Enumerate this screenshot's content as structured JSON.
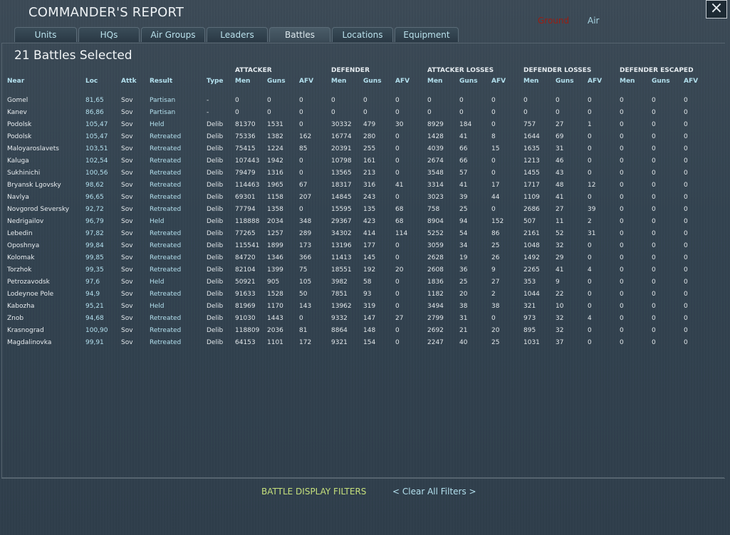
{
  "window": {
    "title": "COMMANDER'S REPORT",
    "close_label": "×"
  },
  "mode": {
    "ground": "Ground",
    "air": "Air"
  },
  "tabs": [
    {
      "label": "Units"
    },
    {
      "label": "HQs"
    },
    {
      "label": "Air Groups"
    },
    {
      "label": "Leaders"
    },
    {
      "label": "Battles",
      "active": true
    },
    {
      "label": "Locations"
    },
    {
      "label": "Equipment"
    }
  ],
  "subtitle": "21 Battles Selected",
  "group_headers": {
    "attacker": "ATTACKER",
    "defender": "DEFENDER",
    "attacker_losses": "ATTACKER LOSSES",
    "defender_losses": "DEFENDER LOSSES",
    "defender_escaped": "DEFENDER ESCAPED"
  },
  "columns": [
    "Near",
    "Loc",
    "Attk",
    "Result",
    "Type",
    "Men",
    "Guns",
    "AFV",
    "Men",
    "Guns",
    "AFV",
    "Men",
    "Guns",
    "AFV",
    "Men",
    "Guns",
    "AFV",
    "Men",
    "Guns",
    "AFV"
  ],
  "rows": [
    [
      "Gomel",
      "81,65",
      "Sov",
      "Partisan",
      "-",
      "0",
      "0",
      "0",
      "0",
      "0",
      "0",
      "0",
      "0",
      "0",
      "0",
      "0",
      "0",
      "0",
      "0",
      "0"
    ],
    [
      "Kanev",
      "86,86",
      "Sov",
      "Partisan",
      "-",
      "0",
      "0",
      "0",
      "0",
      "0",
      "0",
      "0",
      "0",
      "0",
      "0",
      "0",
      "0",
      "0",
      "0",
      "0"
    ],
    [
      "Podolsk",
      "105,47",
      "Sov",
      "Held",
      "Delib",
      "81370",
      "1531",
      "0",
      "30332",
      "479",
      "30",
      "8929",
      "184",
      "0",
      "757",
      "27",
      "1",
      "0",
      "0",
      "0"
    ],
    [
      "Podolsk",
      "105,47",
      "Sov",
      "Retreated",
      "Delib",
      "75336",
      "1382",
      "162",
      "16774",
      "280",
      "0",
      "1428",
      "41",
      "8",
      "1644",
      "69",
      "0",
      "0",
      "0",
      "0"
    ],
    [
      "Maloyaroslavets",
      "103,51",
      "Sov",
      "Retreated",
      "Delib",
      "75415",
      "1224",
      "85",
      "20391",
      "255",
      "0",
      "4039",
      "66",
      "15",
      "1635",
      "31",
      "0",
      "0",
      "0",
      "0"
    ],
    [
      "Kaluga",
      "102,54",
      "Sov",
      "Retreated",
      "Delib",
      "107443",
      "1942",
      "0",
      "10798",
      "161",
      "0",
      "2674",
      "66",
      "0",
      "1213",
      "46",
      "0",
      "0",
      "0",
      "0"
    ],
    [
      "Sukhinichi",
      "100,56",
      "Sov",
      "Retreated",
      "Delib",
      "79479",
      "1316",
      "0",
      "13565",
      "213",
      "0",
      "3548",
      "57",
      "0",
      "1455",
      "43",
      "0",
      "0",
      "0",
      "0"
    ],
    [
      "Bryansk Lgovsky",
      "98,62",
      "Sov",
      "Retreated",
      "Delib",
      "114463",
      "1965",
      "67",
      "18317",
      "316",
      "41",
      "3314",
      "41",
      "17",
      "1717",
      "48",
      "12",
      "0",
      "0",
      "0"
    ],
    [
      "Navlya",
      "96,65",
      "Sov",
      "Retreated",
      "Delib",
      "69301",
      "1158",
      "207",
      "14845",
      "243",
      "0",
      "3023",
      "39",
      "44",
      "1109",
      "41",
      "0",
      "0",
      "0",
      "0"
    ],
    [
      "Novgorod Seversky",
      "92,72",
      "Sov",
      "Retreated",
      "Delib",
      "77794",
      "1358",
      "0",
      "15595",
      "135",
      "68",
      "758",
      "25",
      "0",
      "2686",
      "27",
      "39",
      "0",
      "0",
      "0"
    ],
    [
      "Nedrigailov",
      "96,79",
      "Sov",
      "Held",
      "Delib",
      "118888",
      "2034",
      "348",
      "29367",
      "423",
      "68",
      "8904",
      "94",
      "152",
      "507",
      "11",
      "2",
      "0",
      "0",
      "0"
    ],
    [
      "Lebedin",
      "97,82",
      "Sov",
      "Retreated",
      "Delib",
      "77265",
      "1257",
      "289",
      "34302",
      "414",
      "114",
      "5252",
      "54",
      "86",
      "2161",
      "52",
      "31",
      "0",
      "0",
      "0"
    ],
    [
      "Oposhnya",
      "99,84",
      "Sov",
      "Retreated",
      "Delib",
      "115541",
      "1899",
      "173",
      "13196",
      "177",
      "0",
      "3059",
      "34",
      "25",
      "1048",
      "32",
      "0",
      "0",
      "0",
      "0"
    ],
    [
      "Kolomak",
      "99,85",
      "Sov",
      "Retreated",
      "Delib",
      "84720",
      "1346",
      "366",
      "11413",
      "145",
      "0",
      "2628",
      "19",
      "26",
      "1492",
      "29",
      "0",
      "0",
      "0",
      "0"
    ],
    [
      "Torzhok",
      "99,35",
      "Sov",
      "Retreated",
      "Delib",
      "82104",
      "1399",
      "75",
      "18551",
      "192",
      "20",
      "2608",
      "36",
      "9",
      "2265",
      "41",
      "4",
      "0",
      "0",
      "0"
    ],
    [
      "Petrozavodsk",
      "97,6",
      "Sov",
      "Held",
      "Delib",
      "50921",
      "905",
      "105",
      "3982",
      "58",
      "0",
      "1836",
      "25",
      "27",
      "353",
      "9",
      "0",
      "0",
      "0",
      "0"
    ],
    [
      "Lodeynoe Pole",
      "94,9",
      "Sov",
      "Retreated",
      "Delib",
      "91633",
      "1528",
      "50",
      "7851",
      "93",
      "0",
      "1182",
      "20",
      "2",
      "1044",
      "22",
      "0",
      "0",
      "0",
      "0"
    ],
    [
      "Kabozha",
      "95,21",
      "Sov",
      "Held",
      "Delib",
      "81969",
      "1170",
      "143",
      "13962",
      "319",
      "0",
      "3494",
      "38",
      "38",
      "321",
      "10",
      "0",
      "0",
      "0",
      "0"
    ],
    [
      "Znob",
      "94,68",
      "Sov",
      "Retreated",
      "Delib",
      "91030",
      "1443",
      "0",
      "9332",
      "147",
      "27",
      "2799",
      "31",
      "0",
      "973",
      "32",
      "4",
      "0",
      "0",
      "0"
    ],
    [
      "Krasnograd",
      "100,90",
      "Sov",
      "Retreated",
      "Delib",
      "118809",
      "2036",
      "81",
      "8864",
      "148",
      "0",
      "2692",
      "21",
      "20",
      "895",
      "32",
      "0",
      "0",
      "0",
      "0"
    ],
    [
      "Magdalinovka",
      "99,91",
      "Sov",
      "Retreated",
      "Delib",
      "64153",
      "1101",
      "172",
      "9321",
      "154",
      "0",
      "2247",
      "40",
      "25",
      "1031",
      "37",
      "0",
      "0",
      "0",
      "0"
    ]
  ],
  "footer": {
    "filters_label": "BATTLE DISPLAY FILTERS",
    "clear_filters": "< Clear All Filters >"
  }
}
